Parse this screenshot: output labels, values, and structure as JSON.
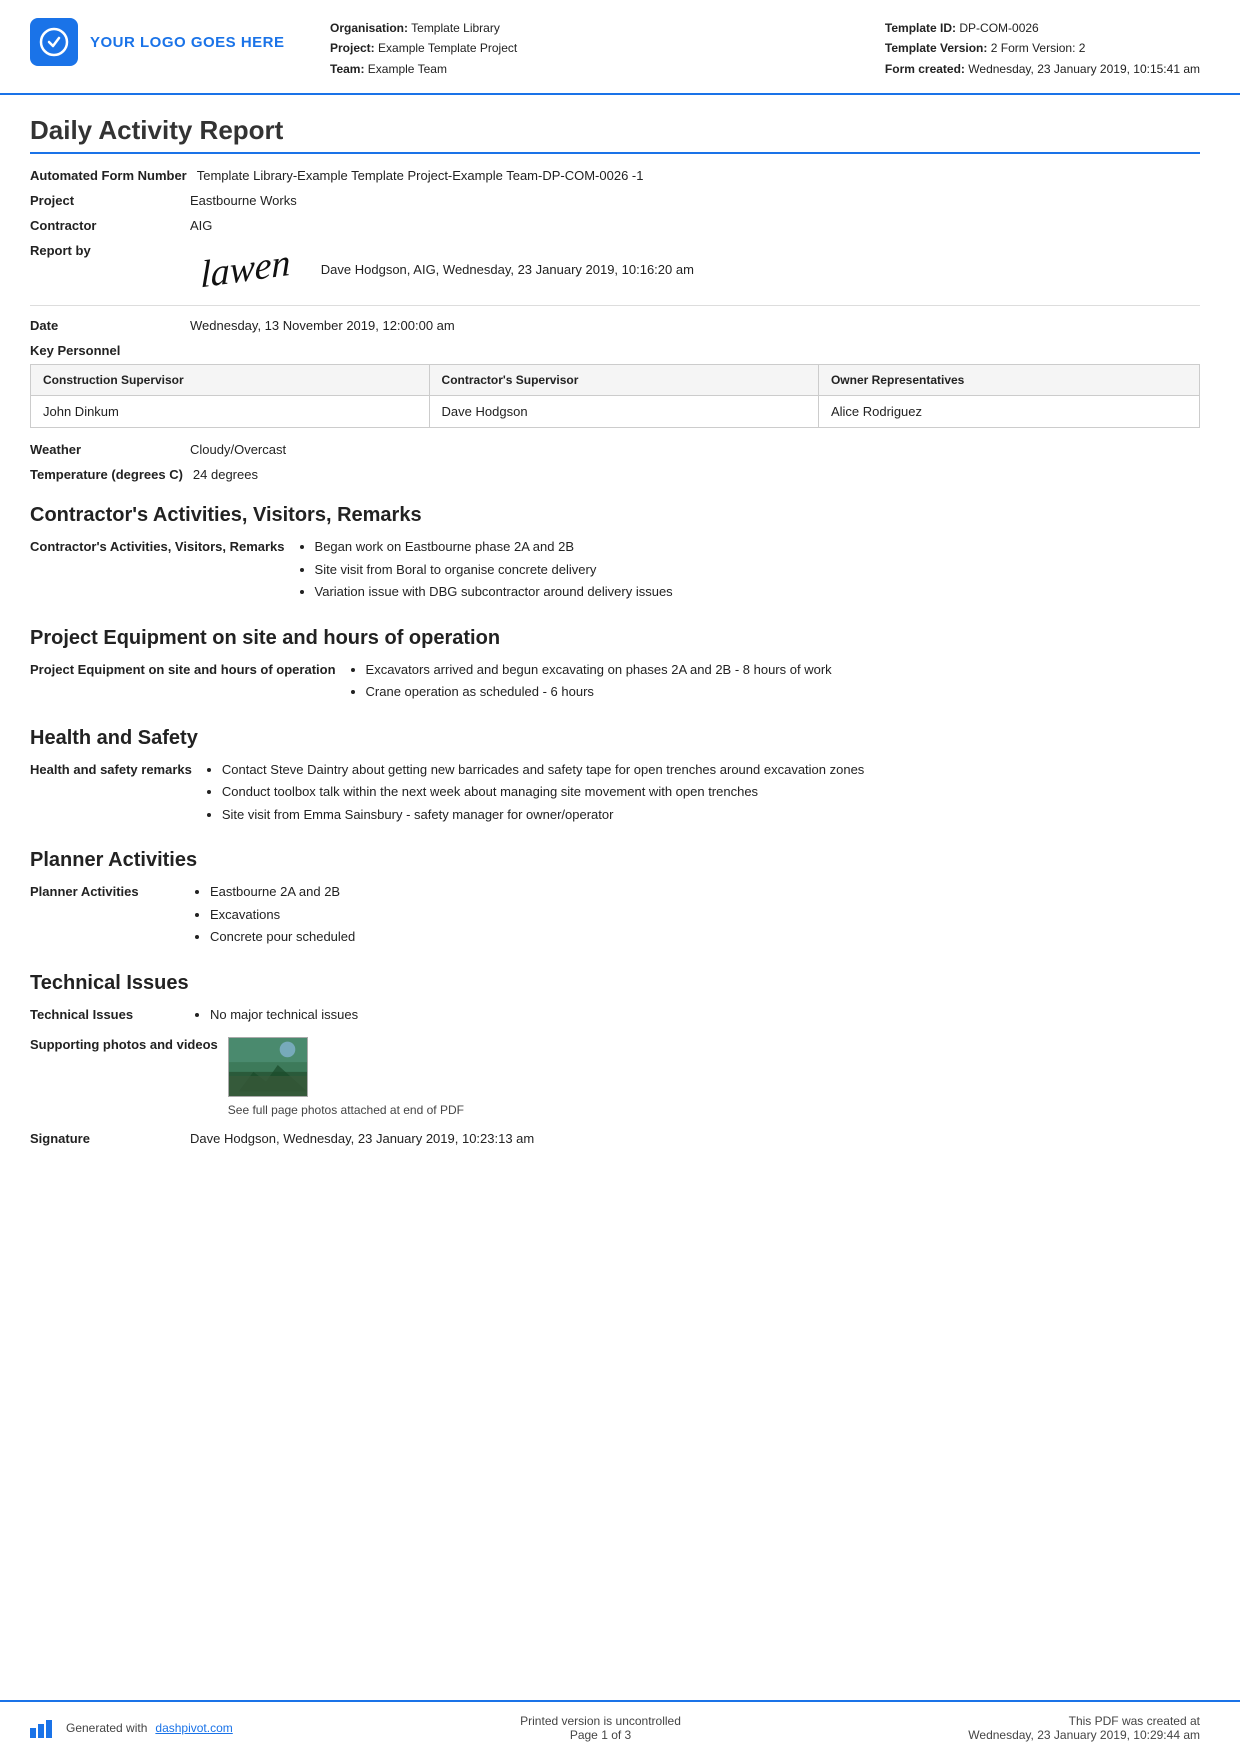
{
  "header": {
    "logo_text": "YOUR LOGO GOES HERE",
    "org_label": "Organisation:",
    "org_value": "Template Library",
    "project_label": "Project:",
    "project_value": "Example Template Project",
    "team_label": "Team:",
    "team_value": "Example Team",
    "template_id_label": "Template ID:",
    "template_id_value": "DP-COM-0026",
    "template_version_label": "Template Version:",
    "template_version_value": "2 Form Version: 2",
    "form_created_label": "Form created:",
    "form_created_value": "Wednesday, 23 January 2019, 10:15:41 am"
  },
  "report": {
    "title": "Daily Activity Report",
    "automated_form_label": "Automated Form Number",
    "automated_form_value": "Template Library-Example Template Project-Example Team-DP-COM-0026   -1",
    "project_label": "Project",
    "project_value": "Eastbourne Works",
    "contractor_label": "Contractor",
    "contractor_value": "AIG",
    "report_by_label": "Report by",
    "report_by_name": "Dave Hodgson, AIG, Wednesday, 23 January 2019, 10:16:20 am",
    "date_label": "Date",
    "date_value": "Wednesday, 13 November 2019, 12:00:00 am"
  },
  "key_personnel": {
    "title": "Key Personnel",
    "col1": "Construction Supervisor",
    "col2": "Contractor's Supervisor",
    "col3": "Owner Representatives",
    "row1_col1": "John Dinkum",
    "row1_col2": "Dave Hodgson",
    "row1_col3": "Alice Rodriguez"
  },
  "weather": {
    "label": "Weather",
    "value": "Cloudy/Overcast",
    "temp_label": "Temperature (degrees C)",
    "temp_value": "24 degrees"
  },
  "contractors_activities": {
    "section_title": "Contractor's Activities, Visitors, Remarks",
    "field_label": "Contractor's Activities, Visitors, Remarks",
    "items": [
      "Began work on Eastbourne phase 2A and 2B",
      "Site visit from Boral to organise concrete delivery",
      "Variation issue with DBG subcontractor around delivery issues"
    ]
  },
  "project_equipment": {
    "section_title": "Project Equipment on site and hours of operation",
    "field_label": "Project Equipment on site and hours of operation",
    "items": [
      "Excavators arrived and begun excavating on phases 2A and 2B - 8 hours of work",
      "Crane operation as scheduled - 6 hours"
    ]
  },
  "health_safety": {
    "section_title": "Health and Safety",
    "field_label": "Health and safety remarks",
    "items": [
      "Contact Steve Daintry about getting new barricades and safety tape for open trenches around excavation zones",
      "Conduct toolbox talk within the next week about managing site movement with open trenches",
      "Site visit from Emma Sainsbury - safety manager for owner/operator"
    ]
  },
  "planner_activities": {
    "section_title": "Planner Activities",
    "field_label": "Planner Activities",
    "items": [
      "Eastbourne 2A and 2B",
      "Excavations",
      "Concrete pour scheduled"
    ]
  },
  "technical_issues": {
    "section_title": "Technical Issues",
    "field_label": "Technical Issues",
    "items": [
      "No major technical issues"
    ],
    "photos_label": "Supporting photos and videos",
    "photos_caption": "See full page photos attached at end of PDF"
  },
  "signature": {
    "label": "Signature",
    "value": "Dave Hodgson, Wednesday, 23 January 2019, 10:23:13 am"
  },
  "footer": {
    "generated_text": "Generated with",
    "site_link": "dashpivot.com",
    "center_text": "Printed version is uncontrolled",
    "page_text": "Page 1 of 3",
    "right_text": "This PDF was created at",
    "right_date": "Wednesday, 23 January 2019, 10:29:44 am"
  }
}
